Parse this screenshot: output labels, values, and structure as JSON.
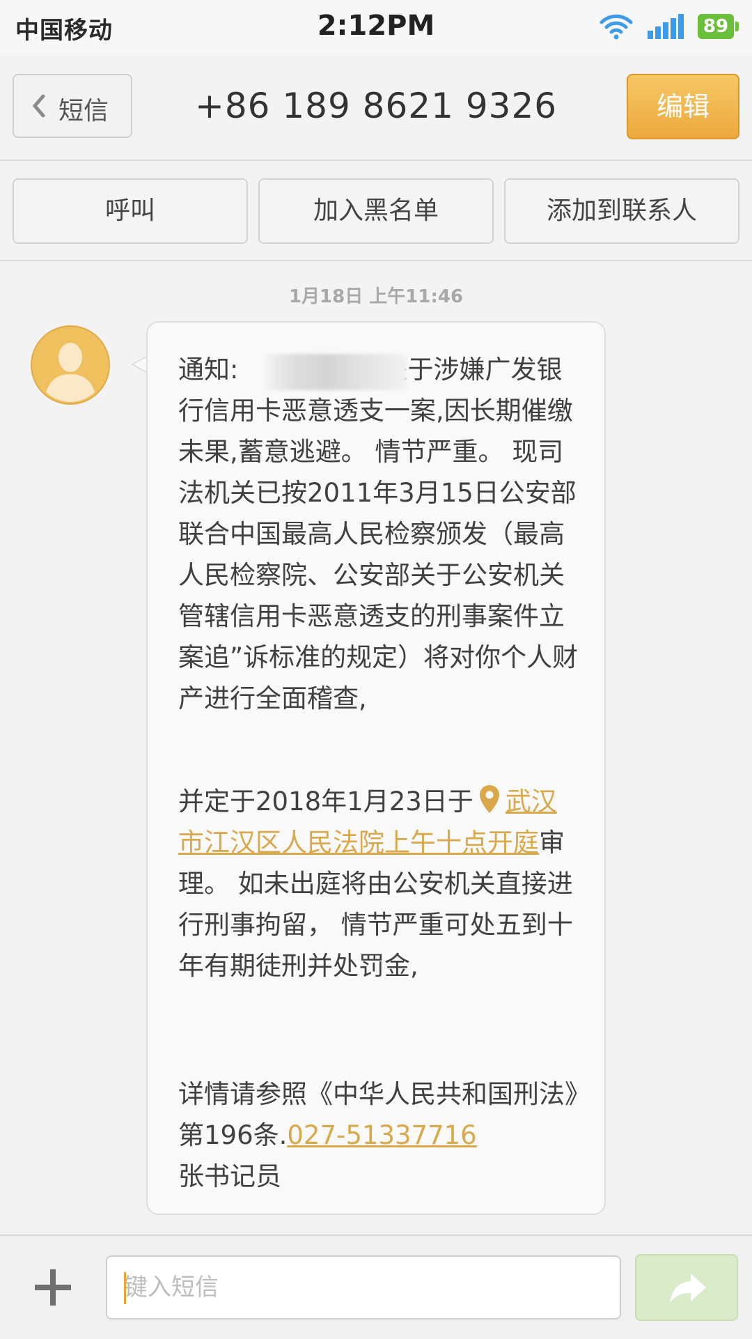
{
  "status_bar": {
    "carrier": "中国移动",
    "time": "2:12PM",
    "battery": "89"
  },
  "header": {
    "back_label": "短信",
    "title": "+86 189 8621 9326",
    "edit_label": "编辑"
  },
  "actions": {
    "call": "呼叫",
    "blacklist": "加入黑名单",
    "add_contact": "添加到联系人"
  },
  "conversation": {
    "timestamp": "1月18日 上午11:46",
    "message": {
      "part1_prefix": "通知:",
      "part1_rest": "关于涉嫌广发银行信用卡恶意透支一案,因长期催缴未果,蓄意逃避。 情节严重。 现司法机关已按2011年3月15日公安部联合中国最高人民检察颁发（最高人民检察院、公安部关于公安机关管辖信用卡恶意透支的刑事案件立案追”诉标准的规定）将对你个人财产进行全面稽查,",
      "part2_prefix": "并定于2018年1月23日于",
      "location_link": "武汉市江汉区人民法院上午十点开庭",
      "part2_rest": "审理。 如未出庭将由公安机关直接进行刑事拘留， 情节严重可处五到十年有期徒刑并处罚金,",
      "part3_prefix": "详情请参照《中华人民共和国刑法》第196条.",
      "phone_link": "027-51337716",
      "signature": "张书记员"
    }
  },
  "input": {
    "placeholder": "键入短信"
  },
  "colors": {
    "accent": "#eca93d",
    "link": "#d8a84a",
    "battery": "#6cbf3a",
    "wifi": "#3d9be9",
    "send_disabled": "#d9ebc9"
  }
}
